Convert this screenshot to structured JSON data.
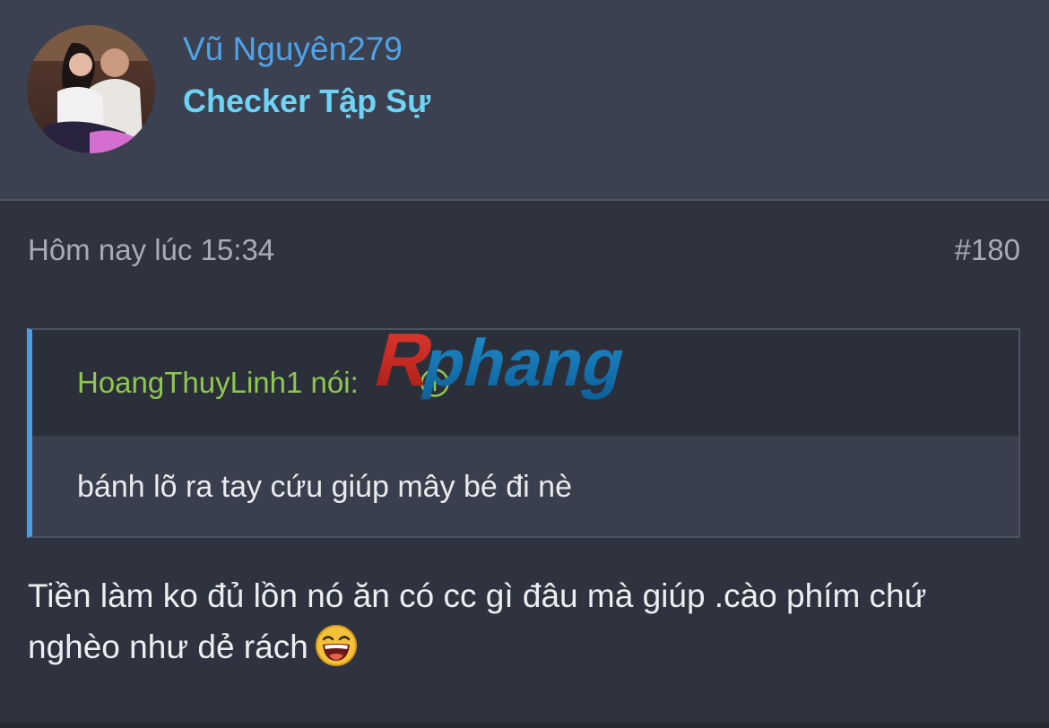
{
  "user": {
    "name": "Vũ Nguyên279",
    "title": "Checker Tập Sự"
  },
  "post": {
    "time": "Hôm nay lúc 15:34",
    "number": "#180",
    "quote": {
      "author": "HoangThuyLinh1",
      "said": "nói:",
      "text": "bánh lõ ra tay cứu giúp mây bé đi nè"
    },
    "body": "Tiền làm ko đủ lồn nó ăn có cc gì đâu mà giúp .cào phím chứ nghèo như dẻ rách"
  },
  "watermark": {
    "text": "Rphang"
  },
  "icons": {
    "quote_arrow": "arrow-up-circle-icon",
    "emoji": "laughing-emoji-icon"
  },
  "colors": {
    "username": "#4fa3ea",
    "user_title": "#6fd3f5",
    "quote_author": "#8fc74f",
    "quote_accent": "#4a9ee8"
  }
}
